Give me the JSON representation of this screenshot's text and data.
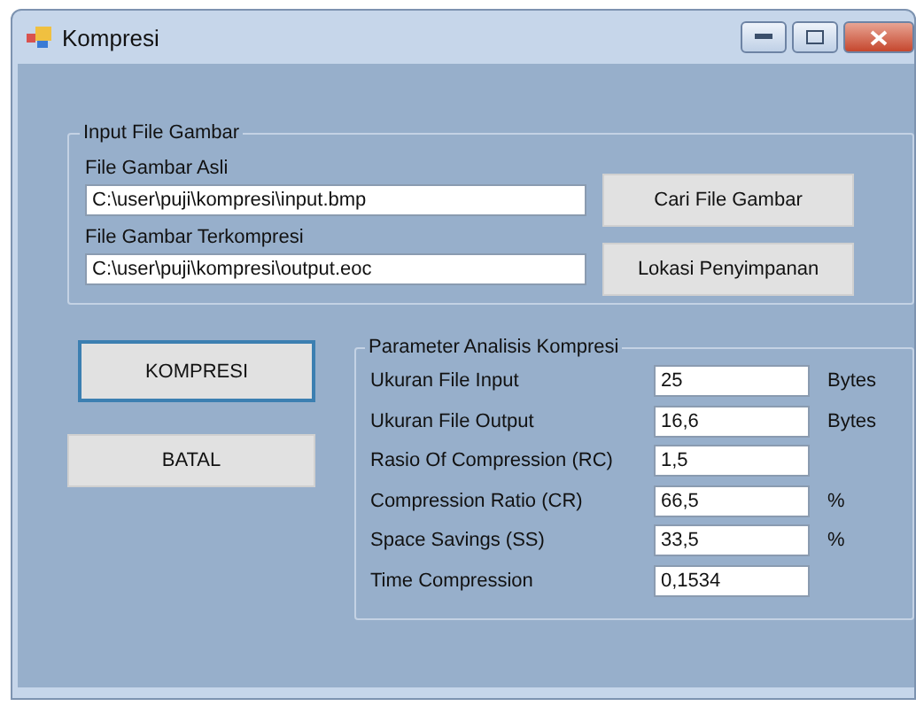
{
  "window": {
    "title": "Kompresi"
  },
  "input_group": {
    "title": "Input File Gambar",
    "fields": [
      {
        "label": "File Gambar Asli",
        "value": "C:\\user\\puji\\kompresi\\input.bmp",
        "button": "Cari File Gambar"
      },
      {
        "label": "File Gambar Terkompresi",
        "value": "C:\\user\\puji\\kompresi\\output.eoc",
        "button": "Lokasi Penyimpanan"
      }
    ]
  },
  "actions": [
    {
      "label": "KOMPRESI",
      "focused": true
    },
    {
      "label": "BATAL",
      "focused": false
    }
  ],
  "parameter_group": {
    "title": "Parameter Analisis Kompresi",
    "rows": [
      {
        "label": "Ukuran File Input",
        "value": "25",
        "unit": "Bytes"
      },
      {
        "label": "Ukuran File Output",
        "value": "16,6",
        "unit": "Bytes"
      },
      {
        "label": "Rasio Of Compression (RC)",
        "value": "1,5"
      },
      {
        "label": "Compression Ratio (CR)",
        "value": "66,5",
        "unit": "%"
      },
      {
        "label": "Space Savings (SS)",
        "value": "33,5",
        "unit": "%"
      },
      {
        "label": "Time Compression",
        "value": "0,1534"
      }
    ]
  }
}
